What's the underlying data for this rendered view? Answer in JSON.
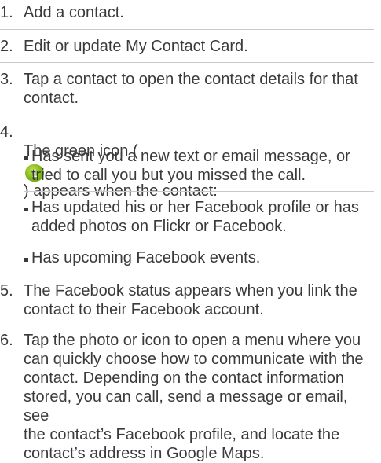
{
  "items": [
    {
      "num": "1.",
      "text": "Add a contact."
    },
    {
      "num": "2.",
      "text": "Edit or update My Contact Card."
    },
    {
      "num": "3.",
      "text": "Tap a contact to open the contact details for that\ncontact."
    },
    {
      "num": "4.",
      "text_before": "The green icon (",
      "icon_label": "1",
      "text_after": ") appears when the contact:",
      "bullets": [
        "Has sent you a new text or email message, or\ntried to call you but you missed the call.",
        "Has updated his or her Facebook profile or has\nadded photos on Flickr or Facebook.",
        "Has upcoming Facebook events."
      ]
    },
    {
      "num": "5.",
      "text": "The Facebook status appears when you link the\ncontact to their Facebook account."
    },
    {
      "num": "6.",
      "text": "Tap the photo or icon to open a menu where you\ncan quickly choose how to communicate with the\ncontact. Depending on the contact information\nstored, you can call, send a message or email, see\nthe contact’s Facebook profile, and locate the\ncontact’s address in Google Maps."
    }
  ],
  "colors": {
    "text": "#3a3a3a",
    "divider": "#c9c9c9",
    "icon_green": "#7fb51a"
  },
  "icons": {
    "green_badge": "green-notification-badge-icon"
  }
}
